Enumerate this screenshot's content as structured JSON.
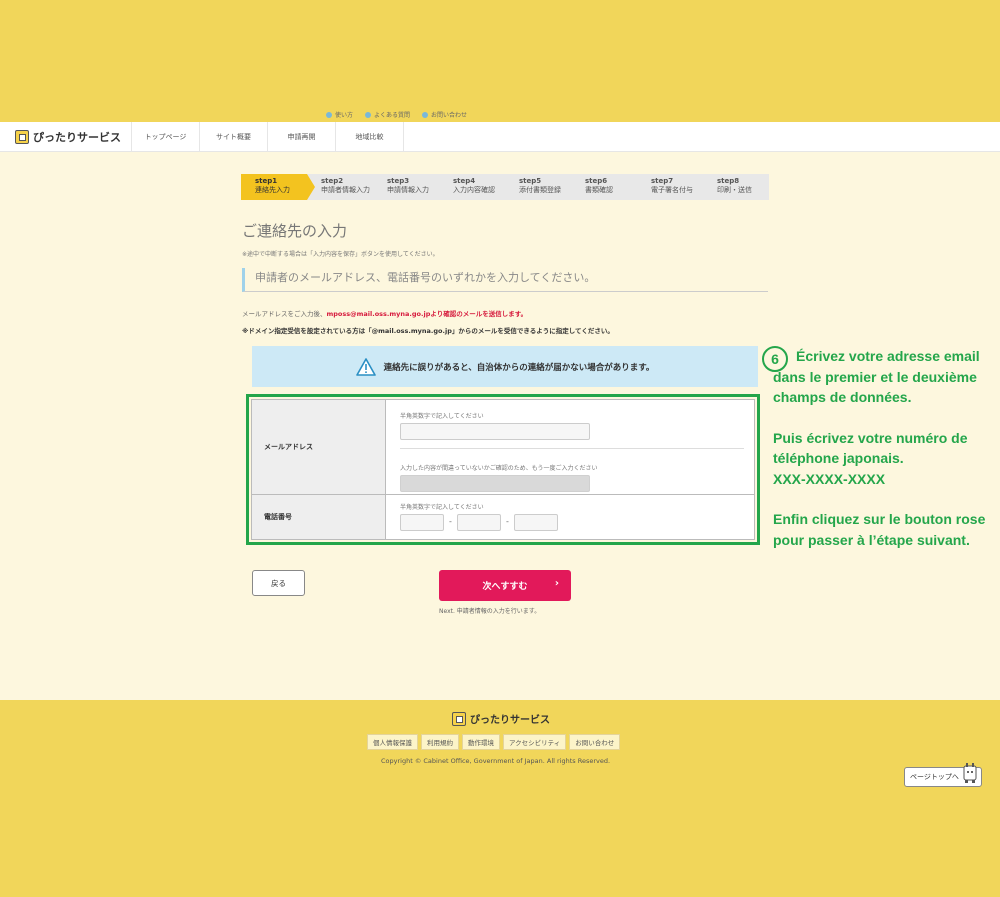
{
  "utility_links": [
    "使い方",
    "よくある質問",
    "お問い合わせ"
  ],
  "header": {
    "logo": "ぴったりサービス",
    "nav": [
      "トップページ",
      "サイト概要",
      "申請再開",
      "地域比較"
    ]
  },
  "steps": [
    {
      "num": "step1",
      "label": "連絡先入力"
    },
    {
      "num": "step2",
      "label": "申請者情報入力"
    },
    {
      "num": "step3",
      "label": "申請情報入力"
    },
    {
      "num": "step4",
      "label": "入力内容確認"
    },
    {
      "num": "step5",
      "label": "添付書類登録"
    },
    {
      "num": "step6",
      "label": "書類確認"
    },
    {
      "num": "step7",
      "label": "電子署名付与"
    },
    {
      "num": "step8",
      "label": "印刷・送信"
    }
  ],
  "page": {
    "title": "ご連絡先の入力",
    "save_note": "※途中で中断する場合は「入力内容を保存」ボタンを使用してください。",
    "subheading": "申請者のメールアドレス、電話番号のいずれかを入力してください。",
    "mail_note_prefix": "メールアドレスをご入力後、",
    "mail_note_red": "mposs@mail.oss.myna.go.jpより確認のメールを送信します。",
    "domain_note": "※ドメイン指定受信を設定されている方は「@mail.oss.myna.go.jp」からのメールを受信できるように指定してください。",
    "warning": "連絡先に誤りがあると、自治体からの連絡が届かない場合があります。"
  },
  "form": {
    "email_label": "メールアドレス",
    "email_hint": "半角英数字で記入してください",
    "email_value": "",
    "email_confirm_hint": "入力した内容が間違っていないかご確認のため、もう一度ご入力ください",
    "email_confirm_value": "",
    "tel_label": "電話番号",
    "tel_hint": "半角英数字で記入してください",
    "tel_part1": "",
    "tel_part2": "",
    "tel_part3": "",
    "tel_separator": "-"
  },
  "buttons": {
    "back": "戻る",
    "next": "次へすすむ",
    "next_note": "Next. 申請者情報の入力を行います。"
  },
  "annotation": {
    "number": "6",
    "para1": "Écrivez votre adresse email dans le premier et le deuxième champs de données.",
    "para2": "Puis écrivez votre numéro de téléphone japonais.",
    "format": "XXX-XXXX-XXXX",
    "para3": "Enfin cliquez sur le bouton rose pour passer à l’étape suivant.",
    "color": "#24a64b"
  },
  "footer": {
    "logo": "ぴったりサービス",
    "links": [
      "個人情報保護",
      "利用規約",
      "動作環境",
      "アクセシビリティ",
      "お問い合わせ"
    ],
    "copyright": "Copyright © Cabinet Office, Government of Japan. All rights Reserved.",
    "page_top": "ページトップへ"
  },
  "colors": {
    "background": "#f1d65a",
    "content_bg": "#fdf7de",
    "active_step": "#f3c31f",
    "next_button": "#e2195a",
    "warning_bg": "#cde9f6",
    "highlight_border": "#23a54a"
  }
}
